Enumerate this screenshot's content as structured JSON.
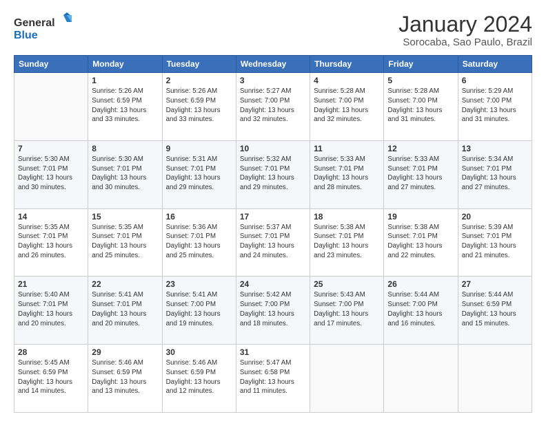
{
  "logo": {
    "text_general": "General",
    "text_blue": "Blue"
  },
  "header": {
    "month": "January 2024",
    "location": "Sorocaba, Sao Paulo, Brazil"
  },
  "weekdays": [
    "Sunday",
    "Monday",
    "Tuesday",
    "Wednesday",
    "Thursday",
    "Friday",
    "Saturday"
  ],
  "weeks": [
    [
      {
        "day": "",
        "info": ""
      },
      {
        "day": "1",
        "info": "Sunrise: 5:26 AM\nSunset: 6:59 PM\nDaylight: 13 hours\nand 33 minutes."
      },
      {
        "day": "2",
        "info": "Sunrise: 5:26 AM\nSunset: 6:59 PM\nDaylight: 13 hours\nand 33 minutes."
      },
      {
        "day": "3",
        "info": "Sunrise: 5:27 AM\nSunset: 7:00 PM\nDaylight: 13 hours\nand 32 minutes."
      },
      {
        "day": "4",
        "info": "Sunrise: 5:28 AM\nSunset: 7:00 PM\nDaylight: 13 hours\nand 32 minutes."
      },
      {
        "day": "5",
        "info": "Sunrise: 5:28 AM\nSunset: 7:00 PM\nDaylight: 13 hours\nand 31 minutes."
      },
      {
        "day": "6",
        "info": "Sunrise: 5:29 AM\nSunset: 7:00 PM\nDaylight: 13 hours\nand 31 minutes."
      }
    ],
    [
      {
        "day": "7",
        "info": "Sunrise: 5:30 AM\nSunset: 7:01 PM\nDaylight: 13 hours\nand 30 minutes."
      },
      {
        "day": "8",
        "info": "Sunrise: 5:30 AM\nSunset: 7:01 PM\nDaylight: 13 hours\nand 30 minutes."
      },
      {
        "day": "9",
        "info": "Sunrise: 5:31 AM\nSunset: 7:01 PM\nDaylight: 13 hours\nand 29 minutes."
      },
      {
        "day": "10",
        "info": "Sunrise: 5:32 AM\nSunset: 7:01 PM\nDaylight: 13 hours\nand 29 minutes."
      },
      {
        "day": "11",
        "info": "Sunrise: 5:33 AM\nSunset: 7:01 PM\nDaylight: 13 hours\nand 28 minutes."
      },
      {
        "day": "12",
        "info": "Sunrise: 5:33 AM\nSunset: 7:01 PM\nDaylight: 13 hours\nand 27 minutes."
      },
      {
        "day": "13",
        "info": "Sunrise: 5:34 AM\nSunset: 7:01 PM\nDaylight: 13 hours\nand 27 minutes."
      }
    ],
    [
      {
        "day": "14",
        "info": "Sunrise: 5:35 AM\nSunset: 7:01 PM\nDaylight: 13 hours\nand 26 minutes."
      },
      {
        "day": "15",
        "info": "Sunrise: 5:35 AM\nSunset: 7:01 PM\nDaylight: 13 hours\nand 25 minutes."
      },
      {
        "day": "16",
        "info": "Sunrise: 5:36 AM\nSunset: 7:01 PM\nDaylight: 13 hours\nand 25 minutes."
      },
      {
        "day": "17",
        "info": "Sunrise: 5:37 AM\nSunset: 7:01 PM\nDaylight: 13 hours\nand 24 minutes."
      },
      {
        "day": "18",
        "info": "Sunrise: 5:38 AM\nSunset: 7:01 PM\nDaylight: 13 hours\nand 23 minutes."
      },
      {
        "day": "19",
        "info": "Sunrise: 5:38 AM\nSunset: 7:01 PM\nDaylight: 13 hours\nand 22 minutes."
      },
      {
        "day": "20",
        "info": "Sunrise: 5:39 AM\nSunset: 7:01 PM\nDaylight: 13 hours\nand 21 minutes."
      }
    ],
    [
      {
        "day": "21",
        "info": "Sunrise: 5:40 AM\nSunset: 7:01 PM\nDaylight: 13 hours\nand 20 minutes."
      },
      {
        "day": "22",
        "info": "Sunrise: 5:41 AM\nSunset: 7:01 PM\nDaylight: 13 hours\nand 20 minutes."
      },
      {
        "day": "23",
        "info": "Sunrise: 5:41 AM\nSunset: 7:00 PM\nDaylight: 13 hours\nand 19 minutes."
      },
      {
        "day": "24",
        "info": "Sunrise: 5:42 AM\nSunset: 7:00 PM\nDaylight: 13 hours\nand 18 minutes."
      },
      {
        "day": "25",
        "info": "Sunrise: 5:43 AM\nSunset: 7:00 PM\nDaylight: 13 hours\nand 17 minutes."
      },
      {
        "day": "26",
        "info": "Sunrise: 5:44 AM\nSunset: 7:00 PM\nDaylight: 13 hours\nand 16 minutes."
      },
      {
        "day": "27",
        "info": "Sunrise: 5:44 AM\nSunset: 6:59 PM\nDaylight: 13 hours\nand 15 minutes."
      }
    ],
    [
      {
        "day": "28",
        "info": "Sunrise: 5:45 AM\nSunset: 6:59 PM\nDaylight: 13 hours\nand 14 minutes."
      },
      {
        "day": "29",
        "info": "Sunrise: 5:46 AM\nSunset: 6:59 PM\nDaylight: 13 hours\nand 13 minutes."
      },
      {
        "day": "30",
        "info": "Sunrise: 5:46 AM\nSunset: 6:59 PM\nDaylight: 13 hours\nand 12 minutes."
      },
      {
        "day": "31",
        "info": "Sunrise: 5:47 AM\nSunset: 6:58 PM\nDaylight: 13 hours\nand 11 minutes."
      },
      {
        "day": "",
        "info": ""
      },
      {
        "day": "",
        "info": ""
      },
      {
        "day": "",
        "info": ""
      }
    ]
  ]
}
